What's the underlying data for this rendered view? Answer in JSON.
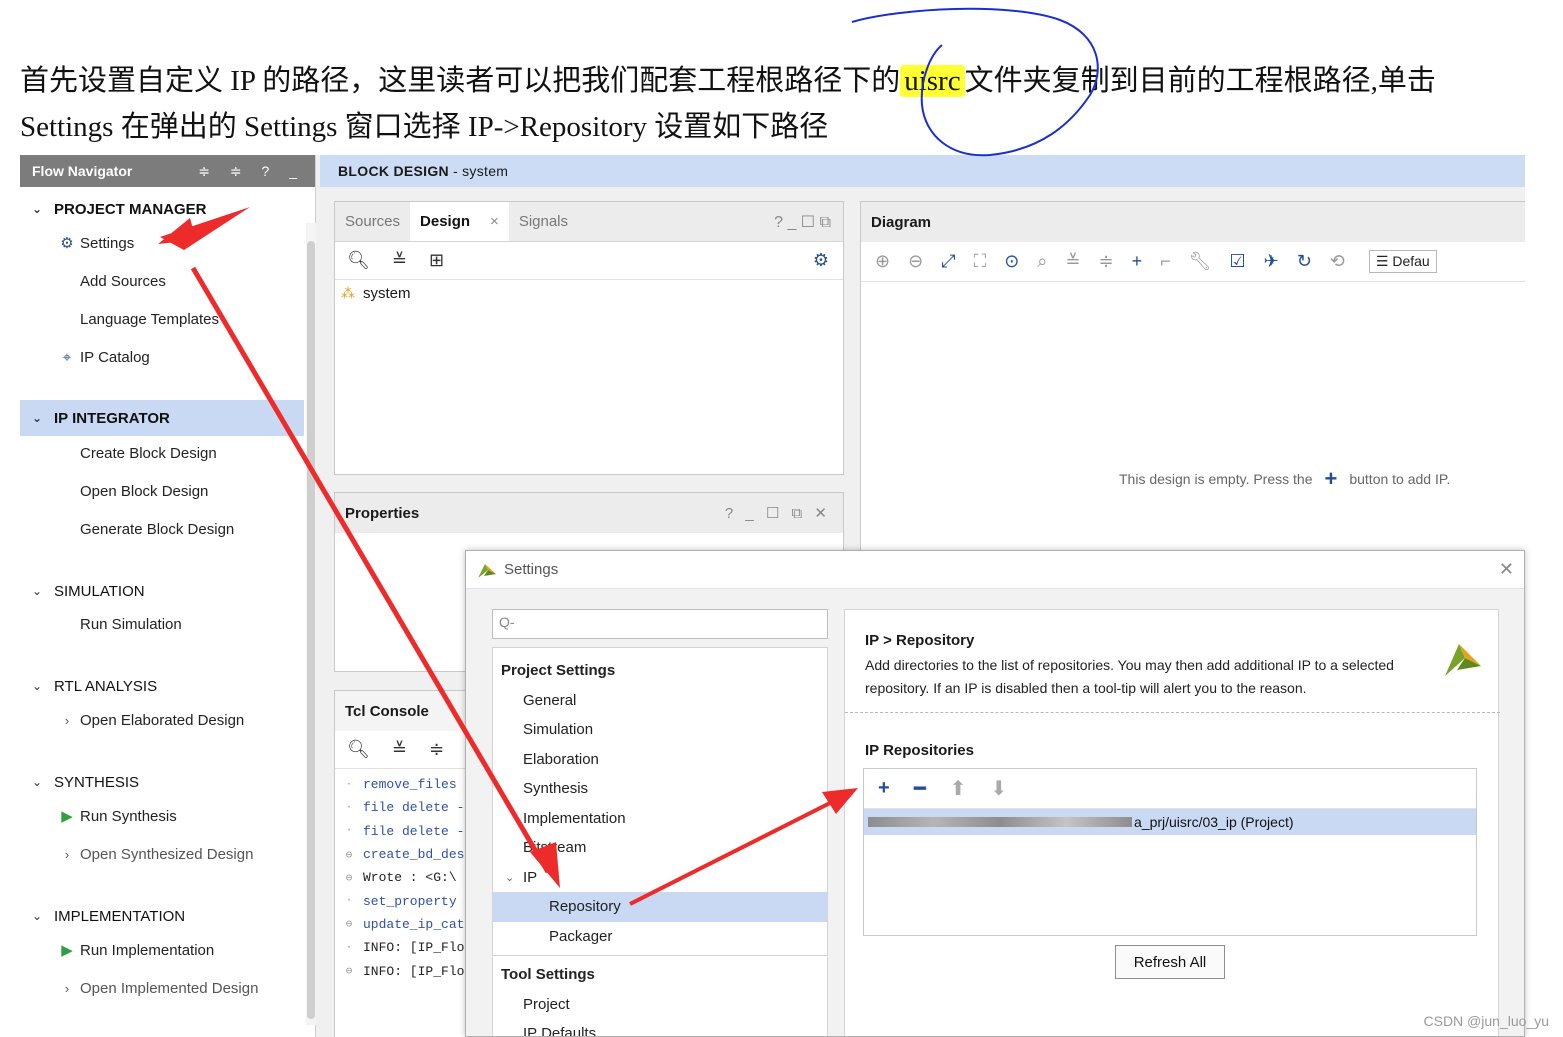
{
  "intro": {
    "line1_before": "首先设置自定义 IP 的路径，这里读者可以把我们配套工程根路径下的",
    "highlight": "uisrc",
    "line1_after": "文件夹复制到目前的工程根路径,单击",
    "line2": "Settings 在弹出的 Settings 窗口选择 IP->Repository  设置如下路径"
  },
  "flow_navigator": {
    "title": "Flow Navigator",
    "header_controls": "≑ ≑ ? _",
    "project_manager": {
      "label": "PROJECT MANAGER",
      "items": [
        "Settings",
        "Add Sources",
        "Language Templates",
        "IP Catalog"
      ]
    },
    "ip_integrator": {
      "label": "IP INTEGRATOR",
      "items": [
        "Create Block Design",
        "Open Block Design",
        "Generate Block Design"
      ]
    },
    "simulation": {
      "label": "SIMULATION",
      "items": [
        "Run Simulation"
      ]
    },
    "rtl_analysis": {
      "label": "RTL ANALYSIS",
      "items": [
        "Open Elaborated Design"
      ]
    },
    "synthesis": {
      "label": "SYNTHESIS",
      "items": [
        "Run Synthesis",
        "Open Synthesized Design"
      ]
    },
    "implementation": {
      "label": "IMPLEMENTATION",
      "items": [
        "Run Implementation",
        "Open Implemented Design"
      ]
    }
  },
  "block_design": {
    "title": "BLOCK DESIGN",
    "subtitle": "- system",
    "sources_panel": {
      "tabs": [
        "Sources",
        "Design",
        "Signals"
      ],
      "tab_tools": "? _ ☐ ⧉",
      "tree_item": "system"
    },
    "properties_panel": {
      "title": "Properties",
      "tools": "? _ ☐ ⧉ ✕"
    },
    "tcl_console": {
      "title": "Tcl Console",
      "lines": [
        "remove_files",
        "file delete -",
        "file delete -",
        "create_bd_des",
        "Wrote  : <G:\\",
        "set_property",
        "update_ip_cat",
        "INFO: [IP_Flo",
        "INFO: [IP_Flo"
      ]
    },
    "diagram": {
      "title": "Diagram",
      "dropdown": "Defau",
      "empty_before": "This design is empty. Press the",
      "empty_after": "button to add IP."
    }
  },
  "settings_dialog": {
    "title": "Settings",
    "search_placeholder": "Q-",
    "nav": {
      "project_settings": "Project Settings",
      "project_items": [
        "General",
        "Simulation",
        "Elaboration",
        "Synthesis",
        "Implementation",
        "Bitstream"
      ],
      "ip_label": "IP",
      "ip_items": [
        "Repository",
        "Packager"
      ],
      "tool_settings": "Tool Settings",
      "tool_items": [
        "Project",
        "IP Defaults"
      ]
    },
    "content": {
      "breadcrumb": "IP > Repository",
      "description": "Add directories to the list of repositories. You may then add additional IP to a selected repository. If an IP is disabled then a tool-tip will alert you to the reason.",
      "repositories_title": "IP Repositories",
      "repository_path_visible": "a_prj/uisrc/03_ip (Project)",
      "refresh_button": "Refresh All"
    }
  },
  "watermark": "CSDN @jun_luo_yu",
  "colors": {
    "annotation_red": "#ee2b2b",
    "circle_blue": "#1a2fd0",
    "highlight_yellow": "#ffff33",
    "selection_blue": "#c9d9f3",
    "accent_blue": "#1f4e9a"
  }
}
